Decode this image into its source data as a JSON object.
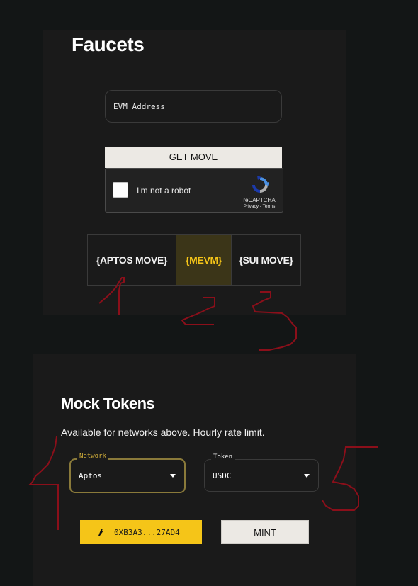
{
  "faucets": {
    "title": "Faucets",
    "address_placeholder": "EVM Address",
    "get_move_label": "GET MOVE",
    "captcha": {
      "label": "I'm not a robot",
      "brand": "reCAPTCHA",
      "links": "Privacy - Terms"
    },
    "network_tabs": [
      {
        "label": "{APTOS MOVE}",
        "selected": false
      },
      {
        "label": "{MEVM}",
        "selected": true
      },
      {
        "label": "{SUI MOVE}",
        "selected": false
      }
    ]
  },
  "mock_tokens": {
    "title": "Mock Tokens",
    "subtitle": "Available for networks above. Hourly rate limit.",
    "network_select": {
      "legend": "Network",
      "value": "Aptos"
    },
    "token_select": {
      "legend": "Token",
      "value": "USDC"
    },
    "wallet_address": "0XB3A3...27AD4",
    "mint_label": "MINT"
  },
  "colors": {
    "accent": "#f5c518",
    "background": "#131616",
    "panel": "#1a1a1a",
    "annotation": "#8b0f1a"
  },
  "annotations": {
    "description_marks": [
      "1",
      "2",
      "3",
      "4",
      "5"
    ]
  }
}
